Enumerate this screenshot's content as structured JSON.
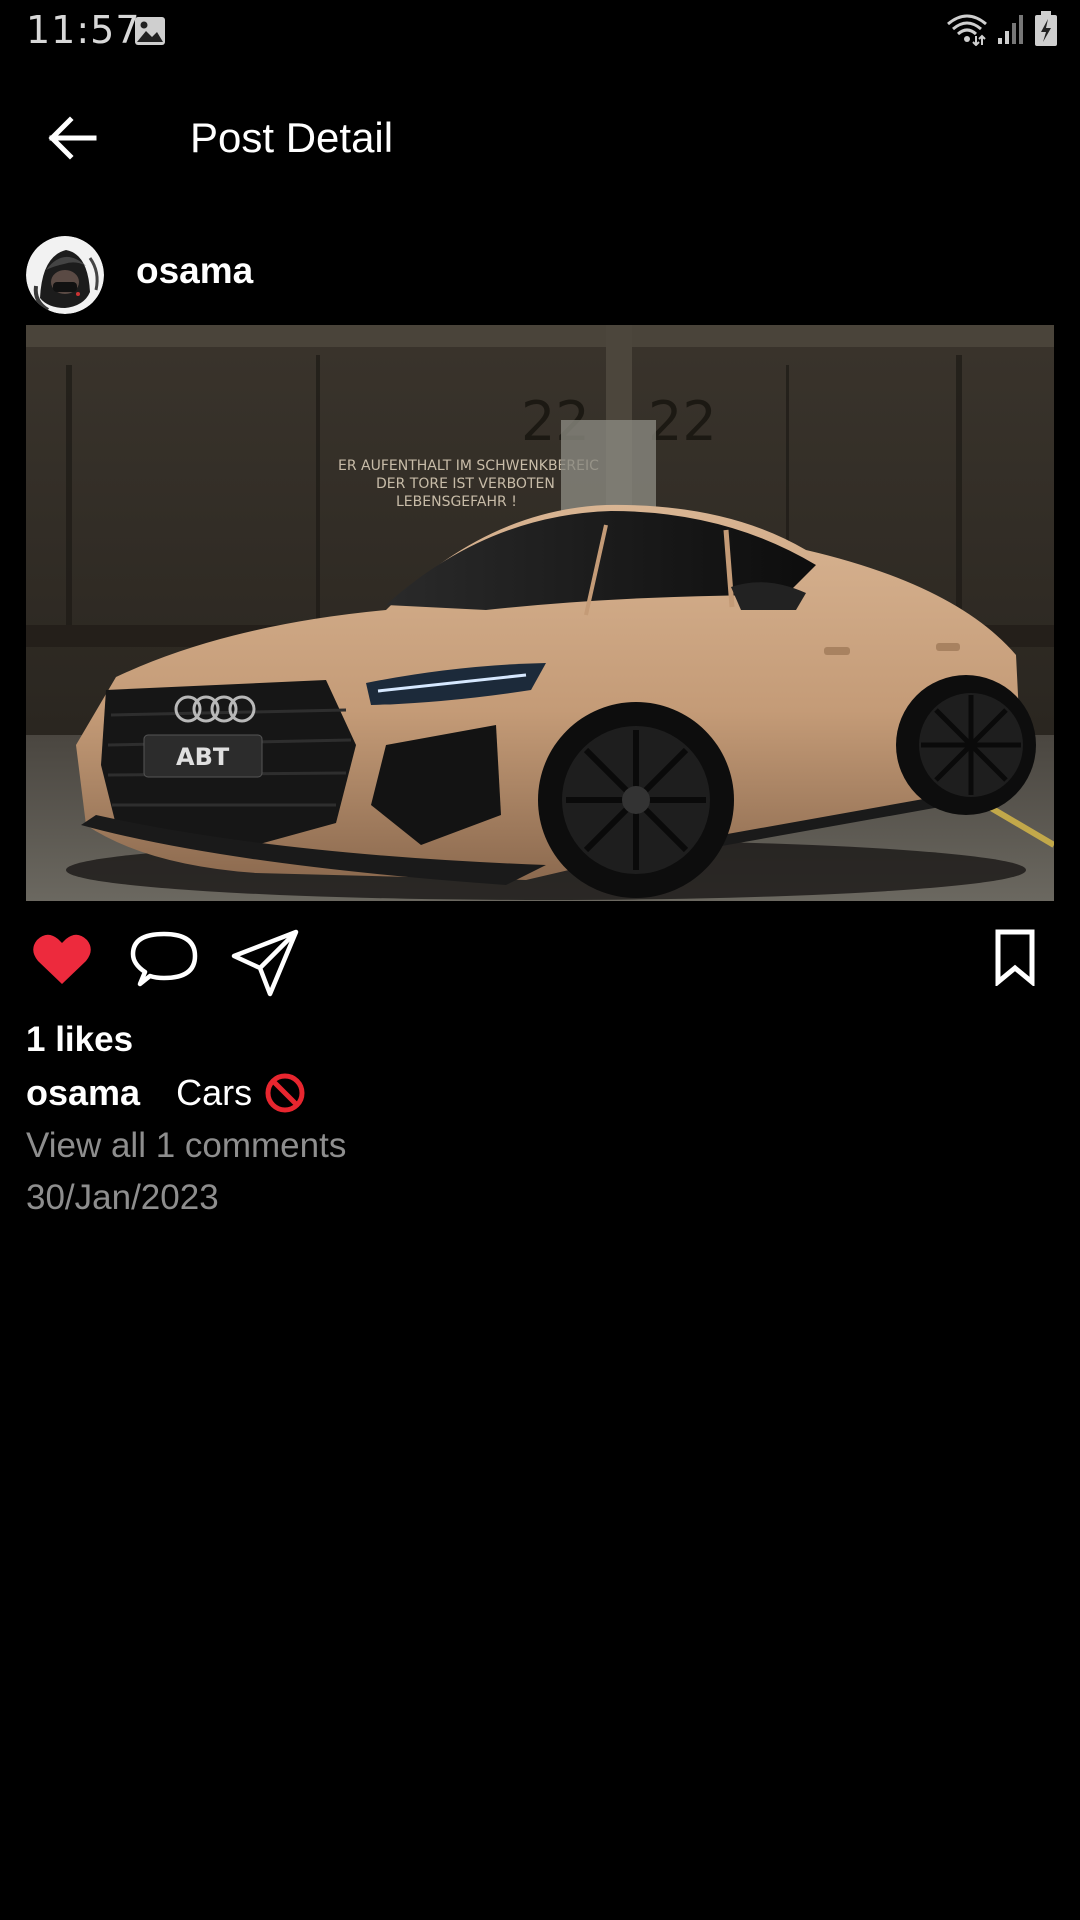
{
  "status_bar": {
    "time": "11:57",
    "icons": [
      "gallery-icon",
      "wifi-icon",
      "signal-icon",
      "battery-charging-icon"
    ]
  },
  "app_bar": {
    "back_icon": "arrow-back-icon",
    "title": "Post Detail"
  },
  "post": {
    "username": "osama",
    "image_icon": "post-photo",
    "actions": {
      "like_icon": "heart-filled-icon",
      "comment_icon": "comment-bubble-icon",
      "share_icon": "send-icon",
      "save_icon": "bookmark-icon",
      "liked": true
    },
    "likes_text": "1 likes",
    "caption_user": "osama",
    "caption_text": "Cars",
    "caption_emoji": "prohibited-emoji",
    "view_comments_text": "View all 1 comments",
    "date": "30/Jan/2023"
  },
  "colors": {
    "background": "#000000",
    "text_primary": "#ffffff",
    "text_secondary": "#8e8e8e",
    "like_red": "#ed2a3d",
    "car_tan": "#c9a07c"
  }
}
